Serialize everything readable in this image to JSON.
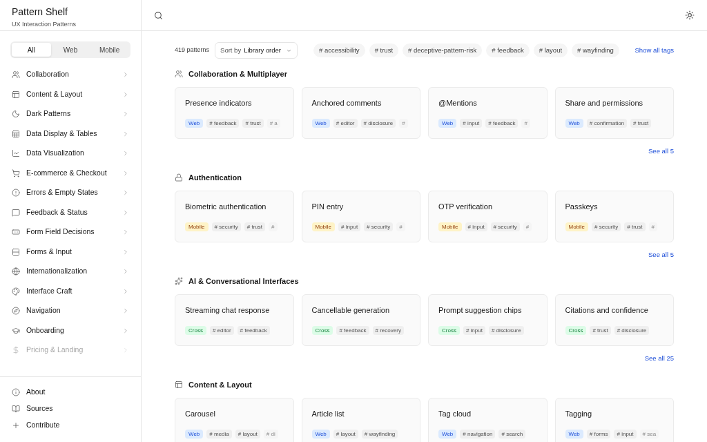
{
  "brand": {
    "title": "Pattern Shelf",
    "subtitle": "UX Interaction Patterns"
  },
  "platform_tabs": [
    {
      "label": "All",
      "selected": true
    },
    {
      "label": "Web",
      "selected": false
    },
    {
      "label": "Mobile",
      "selected": false
    }
  ],
  "sidebar": {
    "items": [
      {
        "label": "Collaboration",
        "faded": false
      },
      {
        "label": "Content & Layout",
        "faded": false
      },
      {
        "label": "Dark Patterns",
        "faded": false
      },
      {
        "label": "Data Display & Tables",
        "faded": false
      },
      {
        "label": "Data Visualization",
        "faded": false
      },
      {
        "label": "E-commerce & Checkout",
        "faded": false
      },
      {
        "label": "Errors & Empty States",
        "faded": false
      },
      {
        "label": "Feedback & Status",
        "faded": false
      },
      {
        "label": "Form Field Decisions",
        "faded": false
      },
      {
        "label": "Forms & Input",
        "faded": false
      },
      {
        "label": "Internationalization",
        "faded": false
      },
      {
        "label": "Interface Craft",
        "faded": false
      },
      {
        "label": "Navigation",
        "faded": false
      },
      {
        "label": "Onboarding",
        "faded": false
      },
      {
        "label": "Pricing & Landing",
        "faded": true
      }
    ],
    "footer": [
      "About",
      "Sources",
      "Contribute"
    ]
  },
  "toolbar": {
    "count": "419 patterns",
    "sort_label": "Sort by",
    "sort_value": "Library order",
    "tags": [
      "# accessibility",
      "# trust",
      "# deceptive-pattern-risk",
      "# feedback",
      "# layout",
      "# wayfinding"
    ],
    "show_all": "Show all tags"
  },
  "sections": [
    {
      "title": "Collaboration & Multiplayer",
      "see_all": "See all 5",
      "cards": [
        {
          "title": "Presence indicators",
          "platform": "Web",
          "kind": "web",
          "tags": [
            "# feedback",
            "# trust"
          ],
          "overflow": "# a"
        },
        {
          "title": "Anchored comments",
          "platform": "Web",
          "kind": "web",
          "tags": [
            "# editor",
            "# disclosure"
          ],
          "overflow": "#"
        },
        {
          "title": "@Mentions",
          "platform": "Web",
          "kind": "web",
          "tags": [
            "# input",
            "# feedback"
          ],
          "overflow": "#"
        },
        {
          "title": "Share and permissions",
          "platform": "Web",
          "kind": "web",
          "tags": [
            "# confirmation",
            "# trust"
          ]
        }
      ]
    },
    {
      "title": "Authentication",
      "see_all": "See all 5",
      "cards": [
        {
          "title": "Biometric authentication",
          "platform": "Mobile",
          "kind": "mobile",
          "tags": [
            "# security",
            "# trust"
          ],
          "overflow": "#"
        },
        {
          "title": "PIN entry",
          "platform": "Mobile",
          "kind": "mobile",
          "tags": [
            "# input",
            "# security"
          ],
          "overflow": "#"
        },
        {
          "title": "OTP verification",
          "platform": "Mobile",
          "kind": "mobile",
          "tags": [
            "# input",
            "# security"
          ],
          "overflow": "#"
        },
        {
          "title": "Passkeys",
          "platform": "Mobile",
          "kind": "mobile",
          "tags": [
            "# security",
            "# trust"
          ],
          "overflow": "#"
        }
      ]
    },
    {
      "title": "AI & Conversational Interfaces",
      "see_all": "See all 25",
      "cards": [
        {
          "title": "Streaming chat response",
          "platform": "Cross",
          "kind": "cross",
          "tags": [
            "# editor",
            "# feedback"
          ]
        },
        {
          "title": "Cancellable generation",
          "platform": "Cross",
          "kind": "cross",
          "tags": [
            "# feedback",
            "# recovery"
          ]
        },
        {
          "title": "Prompt suggestion chips",
          "platform": "Cross",
          "kind": "cross",
          "tags": [
            "# input",
            "# disclosure"
          ]
        },
        {
          "title": "Citations and confidence",
          "platform": "Cross",
          "kind": "cross",
          "tags": [
            "# trust",
            "# disclosure"
          ]
        }
      ]
    },
    {
      "title": "Content & Layout",
      "cards": [
        {
          "title": "Carousel",
          "platform": "Web",
          "kind": "web",
          "tags": [
            "# media",
            "# layout"
          ],
          "overflow": "# di"
        },
        {
          "title": "Article list",
          "platform": "Web",
          "kind": "web",
          "tags": [
            "# layout",
            "# wayfinding"
          ]
        },
        {
          "title": "Tag cloud",
          "platform": "Web",
          "kind": "web",
          "tags": [
            "# navigation",
            "# search"
          ]
        },
        {
          "title": "Tagging",
          "platform": "Web",
          "kind": "web",
          "tags": [
            "# forms",
            "# input"
          ],
          "overflow": "# sea"
        }
      ]
    }
  ]
}
